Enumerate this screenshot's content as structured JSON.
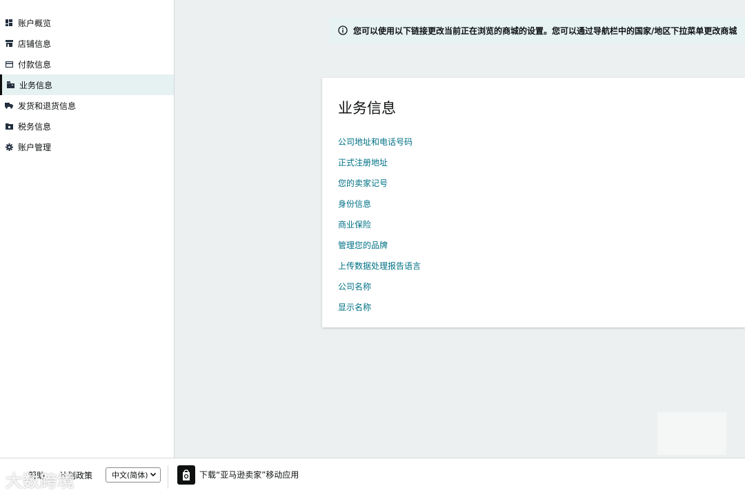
{
  "sidebar": {
    "items": [
      {
        "label": "账户概览",
        "icon": "dashboard-icon",
        "active": false
      },
      {
        "label": "店铺信息",
        "icon": "store-icon",
        "active": false
      },
      {
        "label": "付款信息",
        "icon": "credit-card-icon",
        "active": false
      },
      {
        "label": "业务信息",
        "icon": "building-icon",
        "active": true
      },
      {
        "label": "发货和退货信息",
        "icon": "truck-icon",
        "active": false
      },
      {
        "label": "税务信息",
        "icon": "folder-tax-icon",
        "active": false
      },
      {
        "label": "账户管理",
        "icon": "gear-icon",
        "active": false
      }
    ]
  },
  "banner": {
    "text": "您可以使用以下链接更改当前正在浏览的商城的设置。您可以通过导航栏中的国家/地区下拉菜单更改商城"
  },
  "card": {
    "title": "业务信息",
    "links": [
      "公司地址和电话号码",
      "正式注册地址",
      "您的卖家记号",
      "身份信息",
      "商业保险",
      "管理您的品牌",
      "上传数据处理报告语言",
      "公司名称",
      "显示名称"
    ]
  },
  "footer": {
    "help": "帮助",
    "program_policy": "计划政策",
    "language": "中文(简体)",
    "app_download": "下载“亚马逊卖家”移动应用"
  },
  "watermark": "大数跨境",
  "colors": {
    "link": "#007185",
    "active_bg": "#e6f1f2",
    "main_bg": "#edf0f0",
    "banner_bg": "#e7f2f3"
  }
}
